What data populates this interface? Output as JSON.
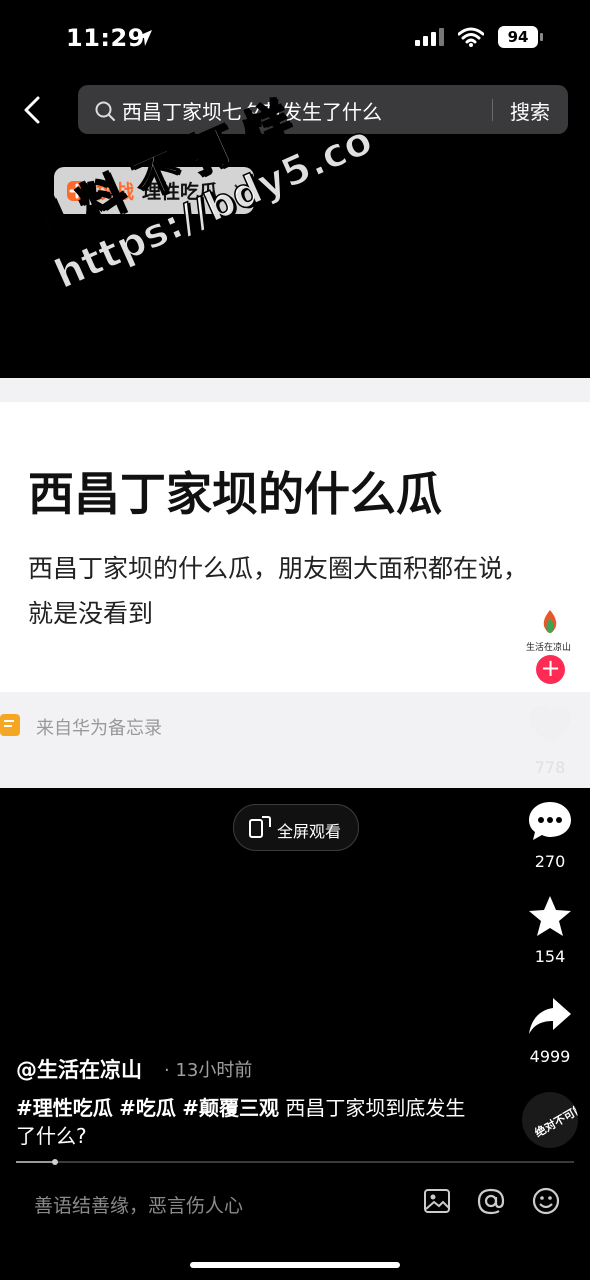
{
  "status_bar": {
    "time": "11:29",
    "battery": "94"
  },
  "search": {
    "query": "西昌丁家坝七夕节发生了什么",
    "button_label": "搜索"
  },
  "challenge_chip": {
    "label": "挑战",
    "topic": "理性吃瓜"
  },
  "watermark": {
    "line1": "黑料不打烊",
    "line2": "https://bdy5.co"
  },
  "video": {
    "note_title": "西昌丁家坝的什么瓜",
    "note_body": "西昌丁家坝的什么瓜，朋友圈大面积都在说，就是没看到",
    "source": "来自华为备忘录",
    "fullscreen_label": "全屏观看"
  },
  "actions": {
    "avatar_name": "生活在凉山",
    "likes": "778",
    "comments": "270",
    "favorites": "154",
    "shares": "4999"
  },
  "post": {
    "author": "@生活在凉山",
    "time_ago": "· 13小时前",
    "tags": [
      "#理性吃瓜",
      "#吃瓜",
      "#颠覆三观"
    ],
    "caption_text": "西昌丁家坝到底发生了什么?"
  },
  "music_disc_label": "绝对不可能",
  "comment": {
    "placeholder": "善语结善缘，恶言伤人心"
  },
  "playback_progress": 0.07,
  "colors": {
    "accent_red": "#fe2c55",
    "chip_orange": "#ff6a2a",
    "background": "#000000"
  }
}
